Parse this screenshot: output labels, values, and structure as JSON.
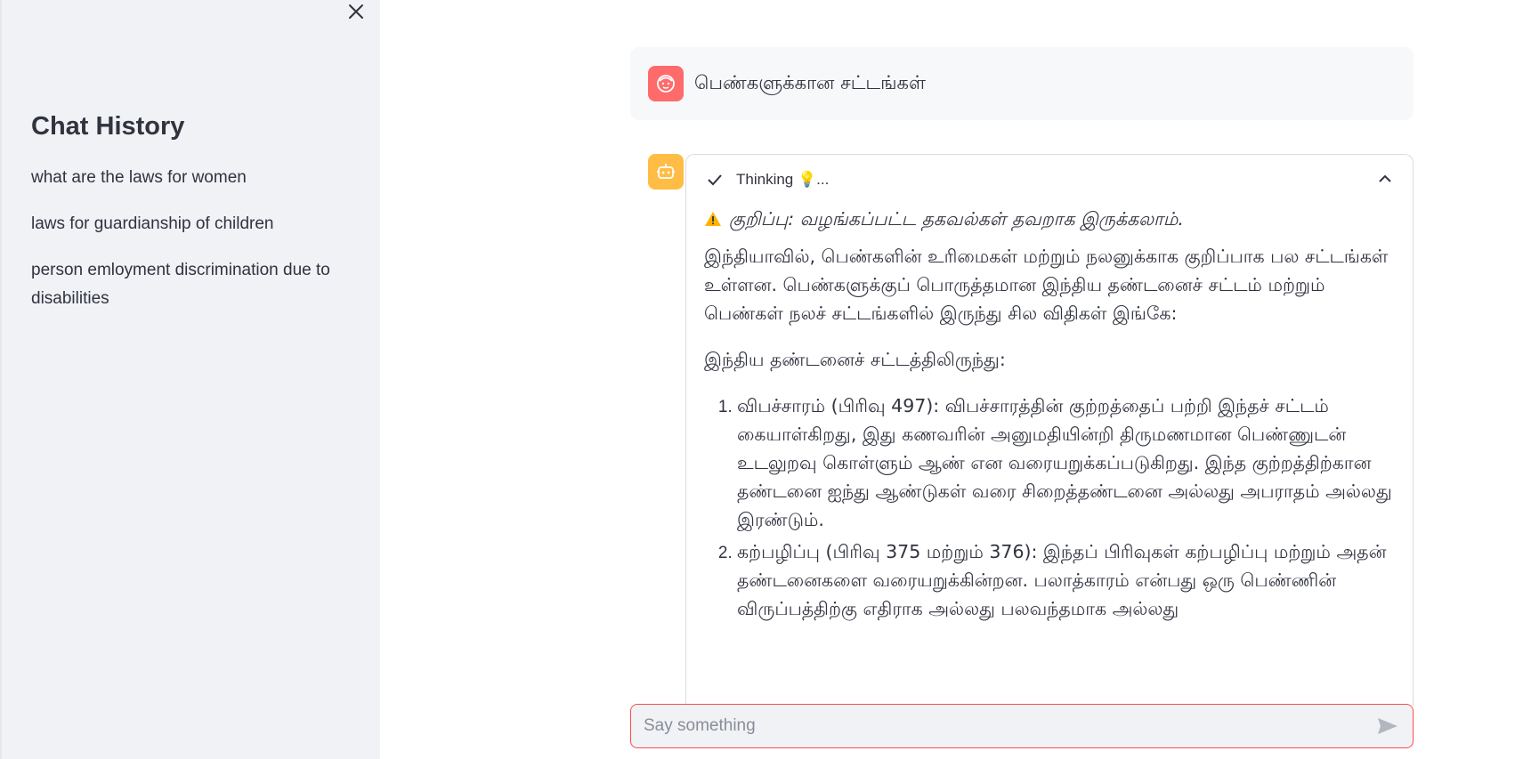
{
  "sidebar": {
    "title": "Chat History",
    "items": [
      {
        "label": "what are the laws for women"
      },
      {
        "label": "laws for guardianship of children"
      },
      {
        "label": "person emloyment discrimination due to disabilities"
      }
    ]
  },
  "chat": {
    "user_message": "பெண்களுக்கான சட்டங்கள்",
    "expander_label": "Thinking 💡...",
    "warning": "குறிப்பு: வழங்கப்பட்ட தகவல்கள் தவறாக இருக்கலாம்.",
    "paragraph1": "இந்தியாவில், பெண்களின் உரிமைகள் மற்றும் நலனுக்காக குறிப்பாக பல சட்டங்கள் உள்ளன. பெண்களுக்குப் பொருத்தமான இந்திய தண்டனைச் சட்டம் மற்றும் பெண்கள் நலச் சட்டங்களில் இருந்து சில விதிகள் இங்கே:",
    "paragraph2": "இந்திய தண்டனைச் சட்டத்திலிருந்து:",
    "list": [
      {
        "text": "விபச்சாரம் (பிரிவு 497): விபச்சாரத்தின் குற்றத்தைப் பற்றி இந்தச் சட்டம் கையாள்கிறது, இது கணவரின் அனுமதியின்றி திருமணமான பெண்ணுடன் உடலுறவு கொள்ளும் ஆண் என வரையறுக்கப்படுகிறது. இந்த குற்றத்திற்கான தண்டனை ஐந்து ஆண்டுகள் வரை சிறைத்தண்டனை அல்லது அபராதம் அல்லது இரண்டும்."
      },
      {
        "text": "கற்பழிப்பு (பிரிவு 375 மற்றும் 376): இந்தப் பிரிவுகள் கற்பழிப்பு மற்றும் அதன் தண்டனைகளை வரையறுக்கின்றன. பலாத்காரம் என்பது ஒரு பெண்ணின் விருப்பத்திற்கு எதிராக அல்லது பலவந்தமாக அல்லது"
      }
    ]
  },
  "input": {
    "placeholder": "Say something"
  },
  "colors": {
    "user_avatar": "#ff6b6b",
    "bot_avatar": "#ffbd45",
    "input_border": "#ff4b4b",
    "sidebar_bg": "#f0f2f6"
  },
  "icons": {
    "close": "close-icon",
    "user": "user-face-icon",
    "bot": "robot-icon",
    "check": "check-icon",
    "warning": "warning-icon",
    "chevron": "chevron-up-icon",
    "send": "send-icon"
  }
}
